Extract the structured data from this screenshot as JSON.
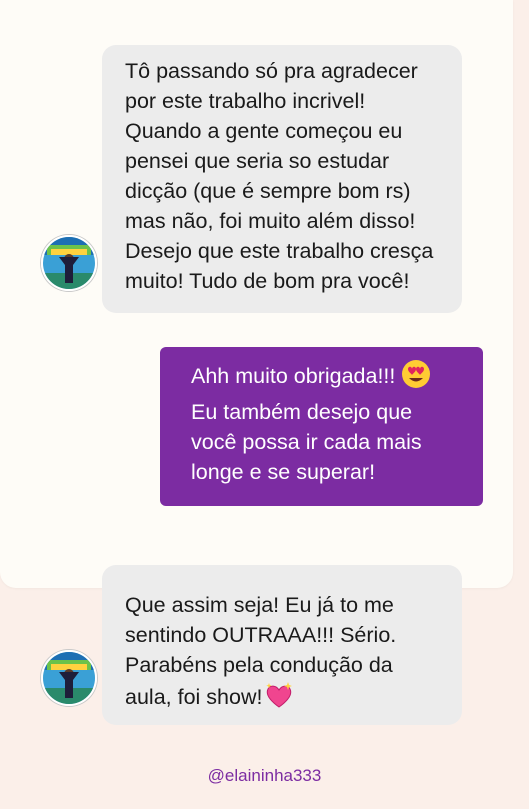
{
  "conversation": {
    "messages": [
      {
        "from": "contact",
        "text": "Tô passando só pra agradecer\npor este trabalho incrivel!\nQuando a gente começou eu\npensei que seria so estudar\ndicção (que é sempre bom rs)\nmas não, foi muito além disso!\nDesejo que este trabalho cresça\nmuito! Tudo de bom pra você!"
      },
      {
        "from": "me",
        "text_first_line": "Ahh muito obrigada!!!",
        "emoji": "heart-eyes-emoji",
        "text_rest": "Eu também desejo que\nvocê possa ir cada mais\nlonge e se superar!"
      },
      {
        "from": "contact",
        "text_main": "Que assim seja! Eu já to me\nsentindo OUTRAAA!!! Sério.\nParabéns pela condução da\naula, foi show!",
        "emoji": "sparkling-heart-emoji"
      }
    ],
    "handle": "@elaininha333"
  },
  "colors": {
    "background": "#fbefe9",
    "card": "#fefcf7",
    "incoming_bubble": "#ececec",
    "outgoing_bubble": "#7c2ca2",
    "handle_text": "#7c2ca2"
  }
}
